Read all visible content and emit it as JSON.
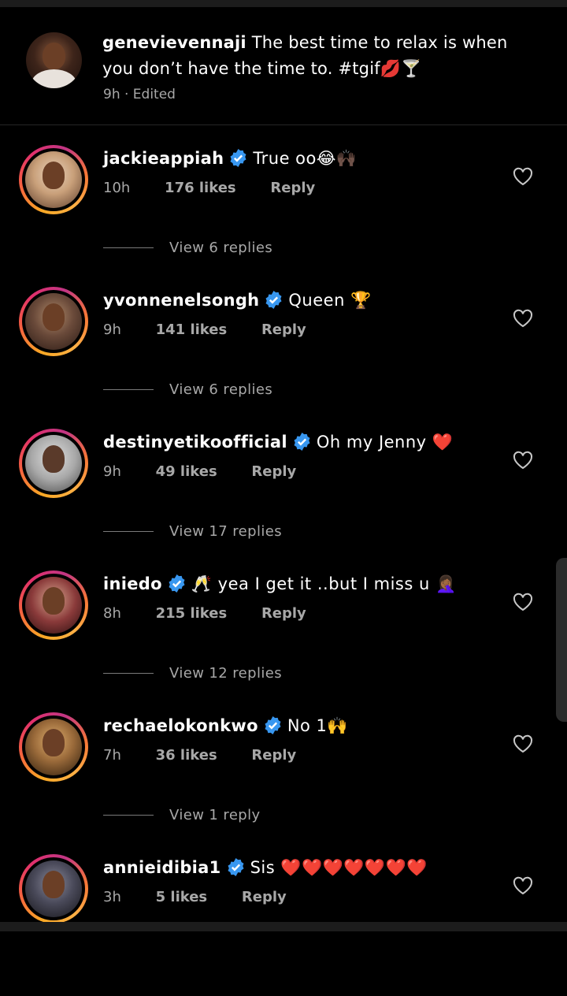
{
  "caption": {
    "username": "genevievennaji",
    "text": "The best time to relax is when you don’t have the time to. #tgif💋🍸",
    "meta": "9h · Edited"
  },
  "comments": [
    {
      "username": "jackieappiah",
      "text": "True oo😂🙌🏿",
      "time": "10h",
      "likes": "176 likes",
      "reply": "Reply",
      "view_replies": "View 6 replies",
      "avatar_color": "#c9a07a"
    },
    {
      "username": "yvonnenelsongh",
      "text": "Queen 🏆",
      "time": "9h",
      "likes": "141 likes",
      "reply": "Reply",
      "view_replies": "View 6 replies",
      "avatar_color": "#7a5a4a"
    },
    {
      "username": "destinyetikoofficial",
      "text": "Oh my Jenny ❤️",
      "time": "9h",
      "likes": "49 likes",
      "reply": "Reply",
      "view_replies": "View 17 replies",
      "avatar_color": "#b8b8b8"
    },
    {
      "username": "iniedo",
      "text": "🥂 yea I get it ..but I miss u 🤦🏾‍♀️",
      "time": "8h",
      "likes": "215 likes",
      "reply": "Reply",
      "view_replies": "View 12 replies",
      "avatar_color": "#8a3a3a"
    },
    {
      "username": "rechaelokonkwo",
      "text": "No 1🙌",
      "time": "7h",
      "likes": "36 likes",
      "reply": "Reply",
      "view_replies": "View 1 reply",
      "avatar_color": "#9a6a3a"
    },
    {
      "username": "annieidibia1",
      "text": "Sis ❤️❤️❤️❤️❤️❤️❤️",
      "time": "3h",
      "likes": "5 likes",
      "reply": "Reply",
      "view_replies": "",
      "avatar_color": "#4a4a5a"
    }
  ],
  "icons": {
    "verified": "verified-badge-icon",
    "like": "heart-outline-icon"
  },
  "colors": {
    "background": "#000000",
    "muted": "#a8a8a8",
    "verified": "#3897f0"
  }
}
